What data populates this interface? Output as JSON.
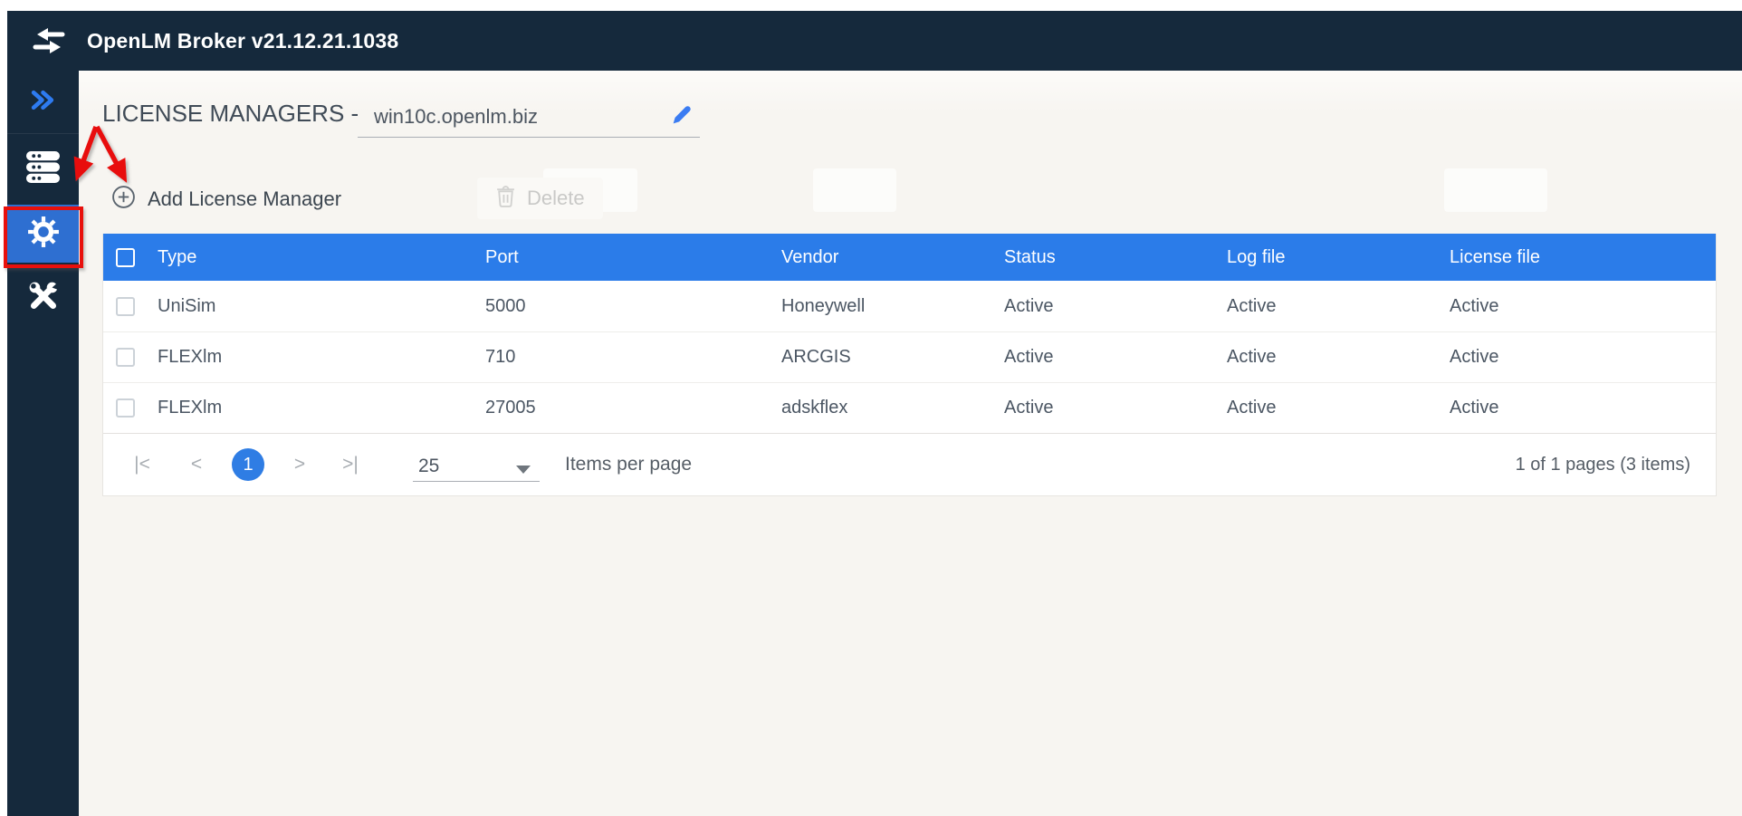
{
  "app": {
    "title": "OpenLM Broker v21.12.21.1038",
    "logo_icon": "swap-arrows-icon"
  },
  "sidebar": {
    "items": [
      {
        "id": "expand",
        "icon": "double-chevron-right-icon",
        "active": false
      },
      {
        "id": "servers",
        "icon": "server-stack-icon",
        "active": false
      },
      {
        "id": "settings",
        "icon": "gear-icon",
        "active": true
      },
      {
        "id": "tools",
        "icon": "tools-icon",
        "active": false
      }
    ]
  },
  "header": {
    "title": "LICENSE MANAGERS -",
    "hostname": "win10c.openlm.biz",
    "edit_icon": "pencil-icon"
  },
  "toolbar": {
    "add_label": "Add License Manager",
    "add_icon": "plus-circle-icon",
    "delete_label": "Delete",
    "delete_icon": "trash-icon",
    "delete_enabled": false
  },
  "table": {
    "columns": [
      "Type",
      "Port",
      "Vendor",
      "Status",
      "Log file",
      "License file"
    ],
    "rows": [
      {
        "type": "UniSim",
        "port": "5000",
        "vendor": "Honeywell",
        "status": "Active",
        "log_file": "Active",
        "license_file": "Active"
      },
      {
        "type": "FLEXlm",
        "port": "710",
        "vendor": "ARCGIS",
        "status": "Active",
        "log_file": "Active",
        "license_file": "Active"
      },
      {
        "type": "FLEXlm",
        "port": "27005",
        "vendor": "adskflex",
        "status": "Active",
        "log_file": "Active",
        "license_file": "Active"
      }
    ]
  },
  "pagination": {
    "first": "|<",
    "prev": "<",
    "current_page": "1",
    "next": ">",
    "last": ">|",
    "page_size": "25",
    "items_per_page_label": "Items per page",
    "summary": "1 of 1 pages (3 items)"
  },
  "annotations": {
    "color": "#e8100c",
    "box_target": "settings-sidebar-item",
    "arrow_targets": [
      "settings-sidebar-item",
      "add-license-manager-button"
    ]
  },
  "colors": {
    "navy": "#15293c",
    "active_blue": "#2e6fd1",
    "header_blue": "#2b7ce9",
    "accent_blue": "#3b7cf2",
    "red": "#e8100c",
    "page_bg": "#f7f5f1"
  }
}
